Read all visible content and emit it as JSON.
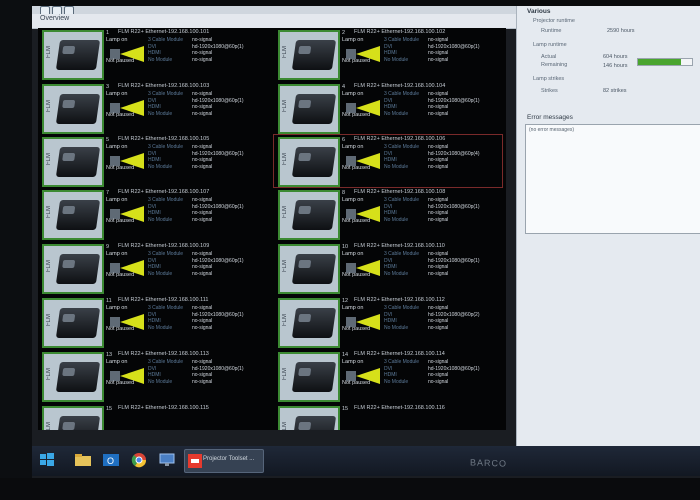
{
  "window": {
    "menu_label": "Overview"
  },
  "tiles": [
    {
      "num": "1",
      "title": "FLM R22+ Ethernet-192.168.100.101",
      "lamp": "Lamp on",
      "paused": "Not paused",
      "mods": [
        "3 Cable Module",
        "DVI",
        "HDMI",
        "No Module"
      ],
      "sigs": [
        "no-signal",
        "hd-1920x1080@60p(1)",
        "no-signal",
        "no-signal"
      ],
      "thumb_label": "FLM"
    },
    {
      "num": "2",
      "title": "FLM R22+ Ethernet-192.168.100.102",
      "lamp": "Lamp on",
      "paused": "Not paused",
      "mods": [
        "3 Cable Module",
        "DVI",
        "HDMI",
        "No Module"
      ],
      "sigs": [
        "no-signal",
        "hd-1920x1080@60p(1)",
        "no-signal",
        "no-signal"
      ],
      "thumb_label": "FLM"
    },
    {
      "num": "3",
      "title": "FLM R22+ Ethernet-192.168.100.103",
      "lamp": "Lamp on",
      "paused": "Not paused",
      "mods": [
        "3 Cable Module",
        "DVI",
        "HDMI",
        "No Module"
      ],
      "sigs": [
        "no-signal",
        "hd-1920x1080@60p(1)",
        "no-signal",
        "no-signal"
      ],
      "thumb_label": "FLM"
    },
    {
      "num": "4",
      "title": "FLM R22+ Ethernet-192.168.100.104",
      "lamp": "Lamp on",
      "paused": "Not paused",
      "mods": [
        "3 Cable Module",
        "DVI",
        "HDMI",
        "No Module"
      ],
      "sigs": [
        "no-signal",
        "hd-1920x1080@60p(1)",
        "no-signal",
        "no-signal"
      ],
      "thumb_label": "FLM"
    },
    {
      "num": "5",
      "title": "FLM R22+ Ethernet-192.168.100.105",
      "lamp": "Lamp on",
      "paused": "Not paused",
      "mods": [
        "3 Cable Module",
        "DVI",
        "HDMI",
        "No Module"
      ],
      "sigs": [
        "no-signal",
        "hd-1920x1080@60p(1)",
        "no-signal",
        "no-signal"
      ],
      "thumb_label": "FLM"
    },
    {
      "num": "6",
      "title": "FLM R22+ Ethernet-192.168.100.106",
      "lamp": "Lamp on",
      "paused": "Not paused",
      "mods": [
        "3 Cable Module",
        "DVI",
        "HDMI",
        "No Module"
      ],
      "sigs": [
        "no-signal",
        "hd-1920x1080@60p(4)",
        "no-signal",
        "no-signal"
      ],
      "thumb_label": "FLM"
    },
    {
      "num": "7",
      "title": "FLM R22+ Ethernet-192.168.100.107",
      "lamp": "Lamp on",
      "paused": "Not paused",
      "mods": [
        "3 Cable Module",
        "DVI",
        "HDMI",
        "No Module"
      ],
      "sigs": [
        "no-signal",
        "hd-1920x1080@60p(1)",
        "no-signal",
        "no-signal"
      ],
      "thumb_label": "FLM"
    },
    {
      "num": "8",
      "title": "FLM R22+ Ethernet-192.168.100.108",
      "lamp": "Lamp on",
      "paused": "Not paused",
      "mods": [
        "3 Cable Module",
        "DVI",
        "HDMI",
        "No Module"
      ],
      "sigs": [
        "no-signal",
        "hd-1920x1080@60p(1)",
        "no-signal",
        "no-signal"
      ],
      "thumb_label": "FLM"
    },
    {
      "num": "9",
      "title": "FLM R22+ Ethernet-192.168.100.109",
      "lamp": "Lamp on",
      "paused": "Not paused",
      "mods": [
        "3 Cable Module",
        "DVI",
        "HDMI",
        "No Module"
      ],
      "sigs": [
        "no-signal",
        "hd-1920x1080@60p(1)",
        "no-signal",
        "no-signal"
      ],
      "thumb_label": "FLM"
    },
    {
      "num": "10",
      "title": "FLM R22+ Ethernet-192.168.100.110",
      "lamp": "Lamp on",
      "paused": "Not paused",
      "mods": [
        "3 Cable Module",
        "DVI",
        "HDMI",
        "No Module"
      ],
      "sigs": [
        "no-signal",
        "hd-1920x1080@60p(1)",
        "no-signal",
        "no-signal"
      ],
      "thumb_label": "FLM"
    },
    {
      "num": "11",
      "title": "FLM R22+ Ethernet-192.168.100.111",
      "lamp": "Lamp on",
      "paused": "Not paused",
      "mods": [
        "3 Cable Module",
        "DVI",
        "HDMI",
        "No Module"
      ],
      "sigs": [
        "no-signal",
        "hd-1920x1080@60p(1)",
        "no-signal",
        "no-signal"
      ],
      "thumb_label": "FLM"
    },
    {
      "num": "12",
      "title": "FLM R22+ Ethernet-192.168.100.112",
      "lamp": "Lamp on",
      "paused": "Not paused",
      "mods": [
        "3 Cable Module",
        "DVI",
        "HDMI",
        "No Module"
      ],
      "sigs": [
        "no-signal",
        "hd-1920x1080@60p(2)",
        "no-signal",
        "no-signal"
      ],
      "thumb_label": "FLM"
    },
    {
      "num": "13",
      "title": "FLM R22+ Ethernet-192.168.100.113",
      "lamp": "Lamp on",
      "paused": "Not paused",
      "mods": [
        "3 Cable Module",
        "DVI",
        "HDMI",
        "No Module"
      ],
      "sigs": [
        "no-signal",
        "hd-1920x1080@60p(1)",
        "no-signal",
        "no-signal"
      ],
      "thumb_label": "FLM"
    },
    {
      "num": "14",
      "title": "FLM R22+ Ethernet-192.168.100.114",
      "lamp": "Lamp on",
      "paused": "Not paused",
      "mods": [
        "3 Cable Module",
        "DVI",
        "HDMI",
        "No Module"
      ],
      "sigs": [
        "no-signal",
        "hd-1920x1080@60p(1)",
        "no-signal",
        "no-signal"
      ],
      "thumb_label": "FLM"
    },
    {
      "num": "15",
      "title": "FLM R22+ Ethernet-192.168.100.115",
      "lamp": "",
      "paused": "",
      "mods": [],
      "sigs": [],
      "thumb_label": "FLM"
    },
    {
      "num": "15",
      "title": "FLM R22+ Ethernet-192.168.100.116",
      "lamp": "",
      "paused": "",
      "mods": [],
      "sigs": [],
      "thumb_label": "FLM"
    }
  ],
  "panel": {
    "various_title": "Various",
    "projector_runtime_label": "Projector runtime",
    "runtime_label": "Runtime",
    "runtime_value": "2590 hours",
    "lamp_runtime_label": "Lamp runtime",
    "actual_label": "Actual",
    "actual_value": "604 hours",
    "remaining_label": "Remaining",
    "remaining_value": "146 hours",
    "lamp_progress": 0.8,
    "lamp_strikes_label": "Lamp strikes",
    "strikes_label": "Strikes",
    "strikes_value": "82 strikes",
    "error_title": "Error messages",
    "error_text": "(no error messages)"
  },
  "taskbar": {
    "active_app_label": "Projector Toolset ..."
  },
  "brand": "BARCO",
  "colors": {
    "lamp_beam": "#d6e01a",
    "thumb_border": "#3c8a33",
    "progress": "#4aa52f"
  }
}
